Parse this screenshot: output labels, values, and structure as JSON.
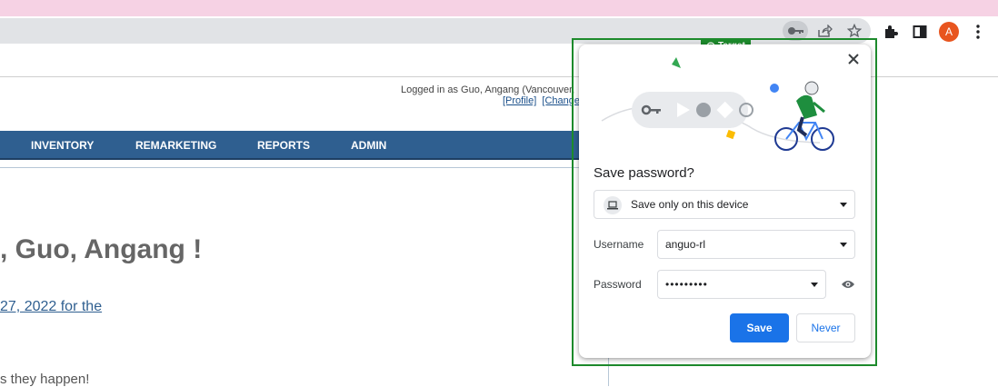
{
  "browser": {
    "avatar_initial": "A",
    "colors": {
      "tabstrip": "#f6d2e4",
      "omnibox": "#e1e3e6",
      "avatar": "#e8551f"
    }
  },
  "header": {
    "login_text": "Logged in as Guo, Angang (Vancouver,",
    "profile_link": "[Profile]",
    "change_link": "[Change"
  },
  "nav": {
    "items": [
      "INVENTORY",
      "REMARKETING",
      "REPORTS",
      "ADMIN"
    ]
  },
  "main": {
    "welcome": ", Guo, Angang !",
    "date_link": "27, 2022 for the",
    "bottom_text": "s they happen!"
  },
  "overlay": {
    "target_label": "Target"
  },
  "popup": {
    "title": "Save password?",
    "device_option": "Save only on this device",
    "username_label": "Username",
    "username_value": "anguo-rl",
    "password_label": "Password",
    "password_value": "•••••••••",
    "save_label": "Save",
    "never_label": "Never",
    "colors": {
      "primary": "#1a73e8"
    }
  }
}
